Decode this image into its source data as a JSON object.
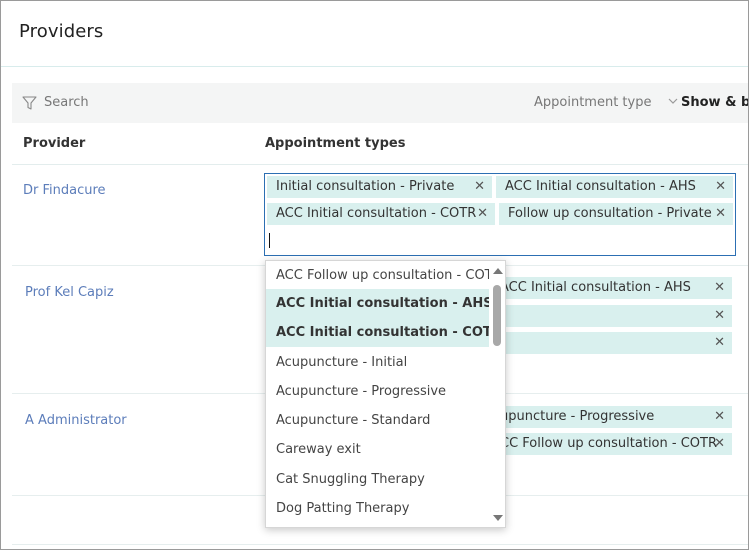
{
  "page": {
    "title": "Providers"
  },
  "toolbar": {
    "search_label": "Search",
    "appointment_type_label": "Appointment type",
    "show_book_label": "Show & boo"
  },
  "columns": {
    "provider": "Provider",
    "appointment_types": "Appointment types"
  },
  "providers": [
    {
      "name": "Dr Findacure",
      "chips": [
        "Initial consultation - Private",
        "ACC Initial consultation - AHS",
        "ACC Initial consultation - COTR",
        "Follow up consultation - Private"
      ]
    },
    {
      "name": "Prof Kel Capiz",
      "chips": [
        "ACC Initial consultation - AHS"
      ]
    },
    {
      "name": "A Administrator",
      "chips": [
        "upuncture - Progressive",
        "CC Follow up consultation - COTR"
      ]
    }
  ],
  "remove_glyph": "✕",
  "dropdown": {
    "options": [
      {
        "label": "ACC Follow up consultation - COTR",
        "selected": false
      },
      {
        "label": "ACC Initial consultation - AHS",
        "selected": true
      },
      {
        "label": "ACC Initial consultation - COTR",
        "selected": true
      },
      {
        "label": "Acupuncture - Initial",
        "selected": false
      },
      {
        "label": "Acupuncture - Progressive",
        "selected": false
      },
      {
        "label": "Acupuncture - Standard",
        "selected": false
      },
      {
        "label": "Careway exit",
        "selected": false
      },
      {
        "label": "Cat Snuggling Therapy",
        "selected": false
      },
      {
        "label": "Dog Patting Therapy",
        "selected": false
      }
    ]
  },
  "colors": {
    "accent": "#2c6fb3",
    "chip_bg": "#d9f0ee",
    "link": "#5c7dba"
  },
  "icons": {
    "filter": "filter-icon",
    "chevron": "chevron-down-icon",
    "remove": "close-icon",
    "scroll_up": "scroll-up-arrow",
    "scroll_down": "scroll-down-arrow"
  }
}
